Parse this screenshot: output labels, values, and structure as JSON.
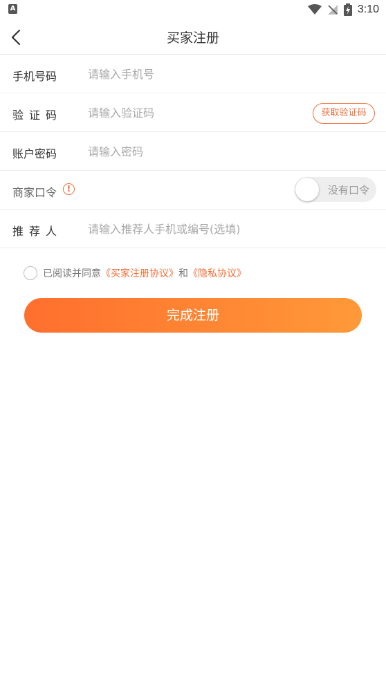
{
  "status_bar": {
    "left_icon": "A",
    "time": "3:10",
    "icons": [
      "wifi-icon",
      "signal-off-icon",
      "battery-charging-icon"
    ]
  },
  "header": {
    "title": "买家注册",
    "back_icon": "chevron-left-icon"
  },
  "form": {
    "phone": {
      "label": "手机号码",
      "placeholder": "请输入手机号"
    },
    "code": {
      "label": "验证码",
      "placeholder": "请输入验证码",
      "button": "获取验证码"
    },
    "password": {
      "label": "账户密码",
      "placeholder": "请输入密码"
    },
    "merchant": {
      "label": "商家口令",
      "warning_icon": "!",
      "toggle_label": "没有口令"
    },
    "referrer": {
      "label": "推荐人",
      "placeholder": "请输入推荐人手机或编号(选填)"
    }
  },
  "agreement": {
    "prefix": "已阅读并同意",
    "link1": "《买家注册协议》",
    "and": "和",
    "link2": "《隐私协议》"
  },
  "submit_label": "完成注册",
  "colors": {
    "accent": "#f0703a",
    "button_start": "#ff6f2e",
    "button_end": "#ff9938"
  }
}
